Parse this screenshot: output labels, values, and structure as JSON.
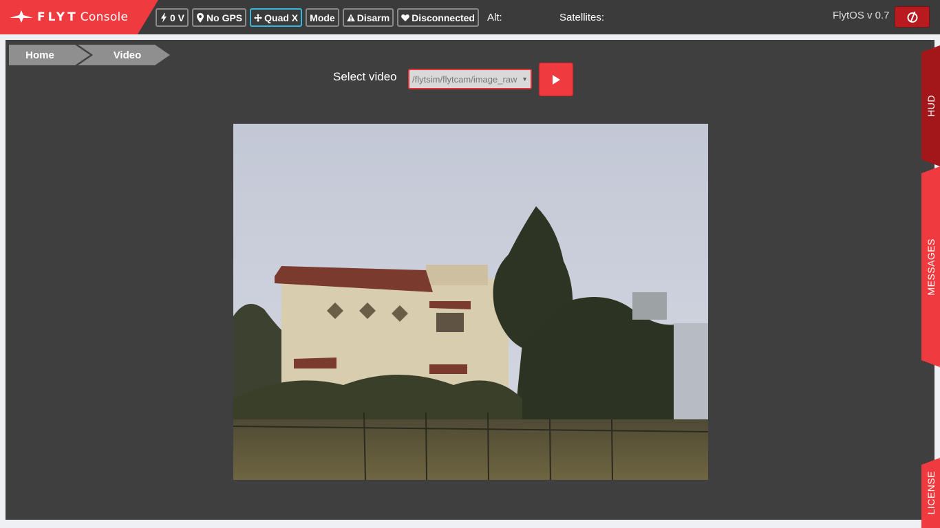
{
  "brand": {
    "name_bold": "FLYT",
    "name_rest": "Console",
    "color": "#ef3b3f"
  },
  "status": {
    "battery": {
      "label": "0 V",
      "icon": "bolt-icon"
    },
    "gps": {
      "label": "No GPS",
      "icon": "map-pin-icon"
    },
    "frame": {
      "label": "Quad X",
      "icon": "move-arrows-icon",
      "accent": "#37b7d9"
    },
    "mode": {
      "label": "Mode"
    },
    "arm": {
      "label": "Disarm",
      "icon": "warning-icon"
    },
    "connection": {
      "label": "Disconnected",
      "icon": "heart-icon"
    },
    "altitude_label": "Alt:",
    "satellites_label": "Satellites:"
  },
  "version": "FlytOS v 0.7",
  "power_button": {
    "icon": "power-icon"
  },
  "breadcrumb": {
    "home": "Home",
    "current": "Video"
  },
  "video": {
    "select_label": "Select video",
    "selected_topic": "/flytsim/flytcam/image_raw",
    "play_icon": "play-icon",
    "feed_image": "camera-feed-image"
  },
  "side_tabs": {
    "hud": "HUD",
    "messages": "MESSAGES",
    "license": "LICENSE"
  }
}
